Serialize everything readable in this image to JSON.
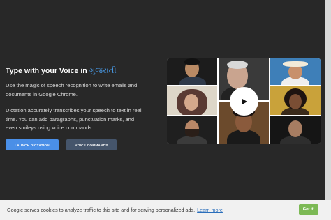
{
  "hero": {
    "headline_prefix": "Type with your Voice in",
    "headline_language": "ગુજરાતી",
    "paragraph1": "Use the magic of speech recognition to write emails and documents in Google Chrome.",
    "paragraph2": "Dictation accurately transcribes your speech to text in real time. You can add paragraphs, punctuation marks, and even smileys using voice commands.",
    "launch_button": "LAUNCH DICTATION",
    "commands_button": "VOICE COMMANDS"
  },
  "video": {
    "play_icon": "play-icon"
  },
  "cookie_banner": {
    "text": "Google serves cookies to analyze traffic to this site and for serving personalized ads.",
    "learn_more": "Learn more",
    "accept_button": "Got it!"
  },
  "colors": {
    "background": "#282828",
    "accent": "#4a8fe7",
    "secondary_button": "#45556b",
    "accept_green": "#7cb955",
    "language_blue": "#4a9eed"
  }
}
